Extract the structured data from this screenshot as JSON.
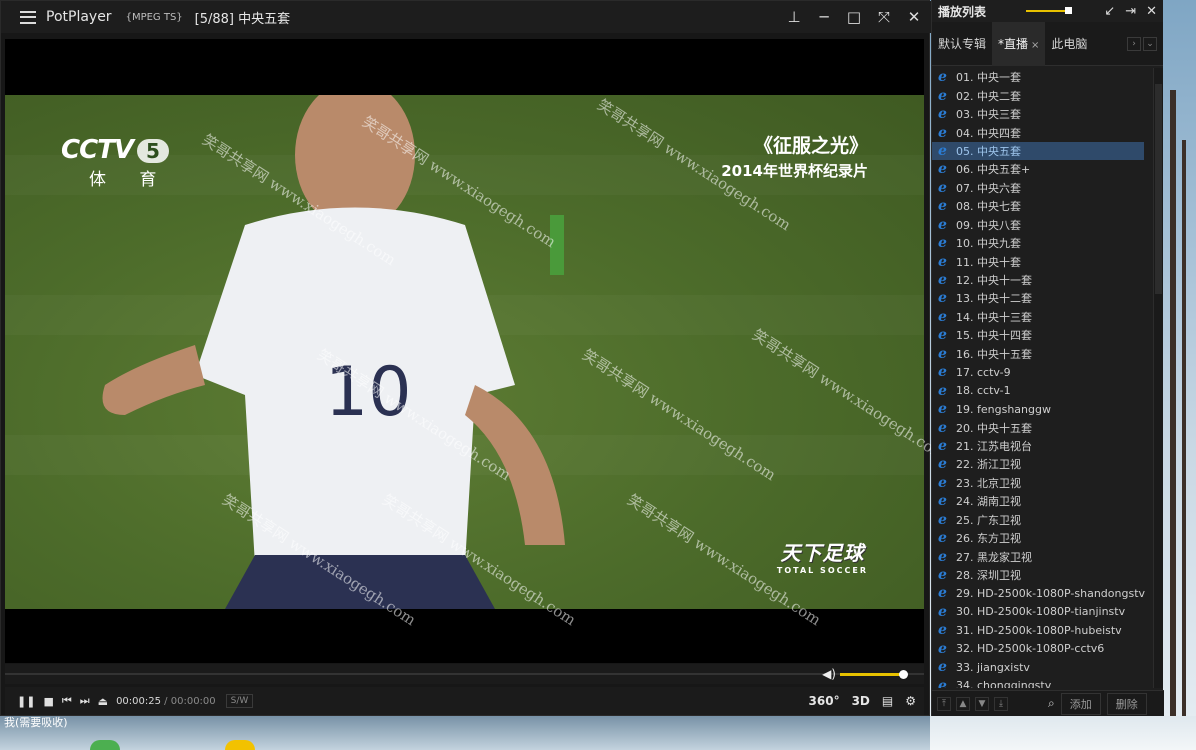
{
  "player": {
    "app_name": "PotPlayer",
    "format": "{MPEG TS}",
    "track": "[5/88] 中央五套",
    "window_controls": [
      "pin",
      "minimize",
      "maximize",
      "fullscreen",
      "close"
    ],
    "video": {
      "channel_logo": "CCTV",
      "channel_number": "5",
      "channel_subtitle": "体 育",
      "program_title": "《征服之光》",
      "program_subtitle": "2014年世界杯纪录片",
      "corner_logo": "天下足球",
      "corner_logo_en": "TOTAL SOCCER",
      "jersey_number": "10",
      "watermark": "笑哥共享网 www.xiaogegh.com"
    },
    "controls": {
      "current_time": "00:00:25",
      "separator": "/",
      "duration": "00:00:00",
      "sw_label": "S/W",
      "right_buttons": [
        "360°",
        "3D"
      ],
      "volume_level": 1.0
    }
  },
  "playlist": {
    "title": "播放列表",
    "tabs": [
      {
        "label": "默认专辑",
        "active": false
      },
      {
        "label": "*直播",
        "active": true
      },
      {
        "label": "此电脑",
        "active": false
      }
    ],
    "items": [
      "01. 中央一套",
      "02. 中央二套",
      "03. 中央三套",
      "04. 中央四套",
      "05. 中央五套",
      "06. 中央五套+",
      "07. 中央六套",
      "08. 中央七套",
      "09. 中央八套",
      "10. 中央九套",
      "11. 中央十套",
      "12. 中央十一套",
      "13. 中央十二套",
      "14. 中央十三套",
      "15. 中央十四套",
      "16. 中央十五套",
      "17. cctv-9",
      "18. cctv-1",
      "19. fengshanggw",
      "20. 中央十五套",
      "21. 江苏电视台",
      "22. 浙江卫视",
      "23. 北京卫视",
      "24. 湖南卫视",
      "25. 广东卫视",
      "26. 东方卫视",
      "27. 黑龙家卫视",
      "28. 深圳卫视",
      "29. HD-2500k-1080P-shandongstv",
      "30. HD-2500k-1080P-tianjinstv",
      "31. HD-2500k-1080P-hubeistv",
      "32. HD-2500k-1080P-cctv6",
      "33. jiangxistv",
      "34. chongqingstv"
    ],
    "selected_index": 4,
    "footer": {
      "add": "添加",
      "delete": "删除"
    }
  },
  "taskbar": {
    "text": "我(需要吸收)"
  }
}
